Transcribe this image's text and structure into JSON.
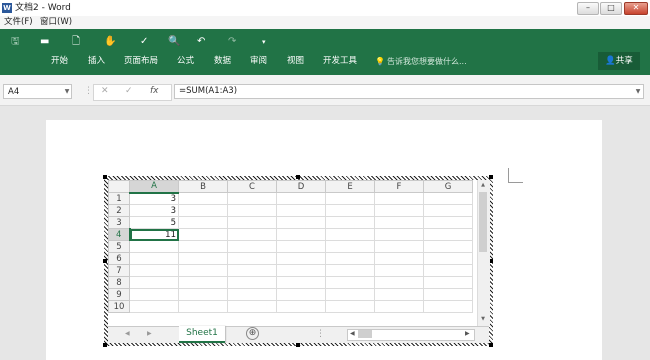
{
  "window": {
    "title": "文档2 - Word",
    "app_icon": "W",
    "minimize": "–",
    "maximize": "□",
    "close": "✕"
  },
  "menubar": [
    "文件(F)",
    "窗口(W)"
  ],
  "quick_access": {
    "save_icon": "🖫",
    "open_icon": "▬",
    "new_icon": "🗋",
    "touch_icon": "✋",
    "format_painter_icon": "✓",
    "preview_icon": "🔍",
    "undo_icon": "↶",
    "redo_icon": "↷",
    "more_icon": "▾"
  },
  "ribbon": {
    "tabs": [
      "开始",
      "插入",
      "页面布局",
      "公式",
      "数据",
      "审阅",
      "视图",
      "开发工具"
    ],
    "tell_me": "告诉我您想要做什么...",
    "share": "共享",
    "color": "#217346"
  },
  "formula_bar": {
    "name_box": "A4",
    "cancel": "✕",
    "enter": "✓",
    "fx": "fx",
    "formula": "=SUM(A1:A3)"
  },
  "sheet": {
    "columns": [
      "A",
      "B",
      "C",
      "D",
      "E",
      "F",
      "G"
    ],
    "rows": [
      "1",
      "2",
      "3",
      "4",
      "5",
      "6",
      "7",
      "8",
      "9",
      "10"
    ],
    "cells": [
      [
        "3",
        "",
        "",
        "",
        "",
        "",
        ""
      ],
      [
        "3",
        "",
        "",
        "",
        "",
        "",
        ""
      ],
      [
        "5",
        "",
        "",
        "",
        "",
        "",
        ""
      ],
      [
        "11",
        "",
        "",
        "",
        "",
        "",
        ""
      ],
      [
        "",
        "",
        "",
        "",
        "",
        "",
        ""
      ],
      [
        "",
        "",
        "",
        "",
        "",
        "",
        ""
      ],
      [
        "",
        "",
        "",
        "",
        "",
        "",
        ""
      ],
      [
        "",
        "",
        "",
        "",
        "",
        "",
        ""
      ],
      [
        "",
        "",
        "",
        "",
        "",
        "",
        ""
      ],
      [
        "",
        "",
        "",
        "",
        "",
        "",
        ""
      ]
    ],
    "selected_cell": "A4",
    "sheet_tab": "Sheet1",
    "add_sheet": "⊕",
    "accent": "#217346"
  }
}
